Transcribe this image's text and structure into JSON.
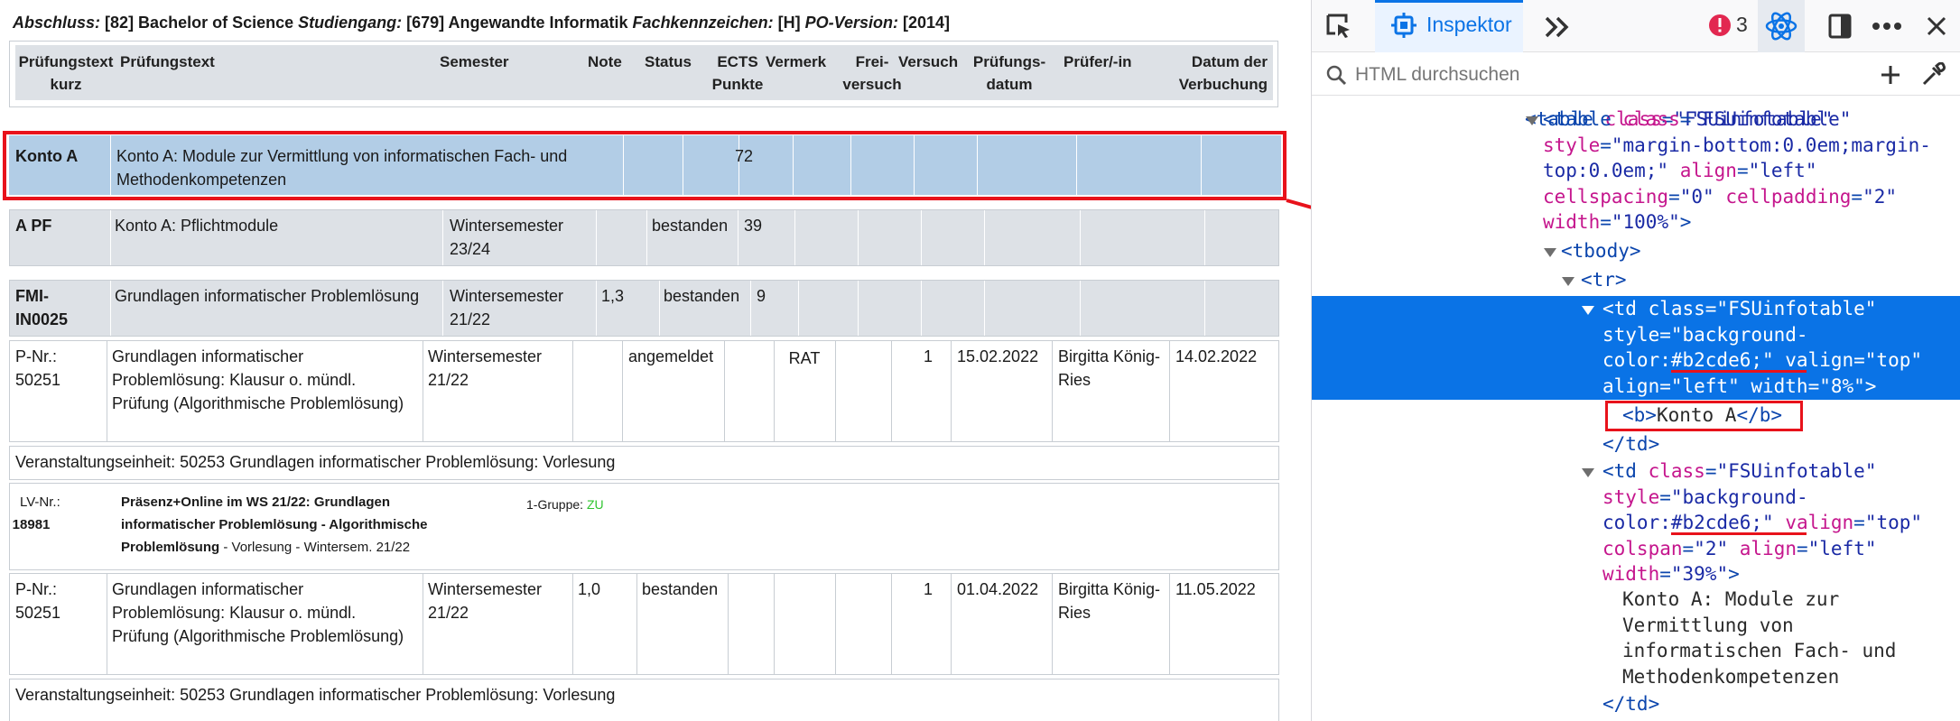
{
  "header": {
    "abschluss_label": "Abschluss:",
    "abschluss_value": "[82] Bachelor of Science",
    "studiengang_label": "Studiengang:",
    "studiengang_value": "[679] Angewandte Informatik",
    "fachkz_label": "Fachkennzeichen:",
    "fachkz_value": "[H]",
    "po_label": "PO-Version:",
    "po_value": "[2014]"
  },
  "columns": {
    "kurz": "Prüfungstext kurz",
    "text": "Prüfungstext",
    "semester": "Semester",
    "note": "Note",
    "status": "Status",
    "ects": "ECTS Punkte",
    "vermerk": "Vermerk",
    "frei": "Frei- versuch",
    "versuch": "Versuch",
    "datum": "Prüfungs- datum",
    "pruefer": "Prüfer/-in",
    "verbuchung": "Datum der Verbuchung"
  },
  "konto_a": {
    "kurz": "Konto A",
    "text": "Konto A: Module zur Vermittlung von informatischen Fach- und Methodenkompetenzen",
    "ects": "72"
  },
  "apf": {
    "kurz": "A PF",
    "text": "Konto A: Pflichtmodule",
    "semester": "Wintersemester 23/24",
    "status": "bestanden",
    "ects": "39"
  },
  "fmi": {
    "kurz": "FMI-IN0025",
    "text": "Grundlagen informatischer Problemlösung",
    "semester": "Wintersemester 21/22",
    "note": "1,3",
    "status": "bestanden",
    "ects": "9"
  },
  "exam1": {
    "pnr": "P-Nr.: 50251",
    "text": "Grundlagen informatischer Problemlösung: Klausur o. mündl. Prüfung (Algorithmische Problemlösung)",
    "semester": "Wintersemester 21/22",
    "status": "angemeldet",
    "vermerk": "RAT",
    "versuch": "1",
    "datum": "15.02.2022",
    "pruefer": "Birgitta König-Ries",
    "verbuchung": "14.02.2022"
  },
  "ve1": "Veranstaltungseinheit: 50253 Grundlagen informatischer Problemlösung: Vorlesung",
  "lv": {
    "label": "LV-Nr.:",
    "nr": "18981",
    "title": "Präsenz+Online im WS 21/22: Grundlagen informatischer Problemlösung - Algorithmische Problemlösung",
    "suffix": " - Vorlesung - Wintersem. 21/22",
    "gruppe": "1-Gruppe:",
    "zu": "ZU",
    "zu_color": "#2fc42f"
  },
  "exam2": {
    "pnr": "P-Nr.: 50251",
    "text": "Grundlagen informatischer Problemlösung: Klausur o. mündl. Prüfung (Algorithmische Problemlösung)",
    "semester": "Wintersemester 21/22",
    "note": "1,0",
    "status": "bestanden",
    "versuch": "1",
    "datum": "01.04.2022",
    "pruefer": "Birgitta König-Ries",
    "verbuchung": "11.05.2022"
  },
  "ve2": "Veranstaltungseinheit: 50253 Grundlagen informatischer Problemlösung: Vorlesung",
  "devtools": {
    "inspector_tab": "Inspektor",
    "error_count": "3",
    "search_placeholder": "HTML durchsuchen",
    "accent_color": "#0a73e6",
    "error_color": "#e22850",
    "highlight_color": "#b2cde6",
    "annotation_color": "#e8121b"
  }
}
